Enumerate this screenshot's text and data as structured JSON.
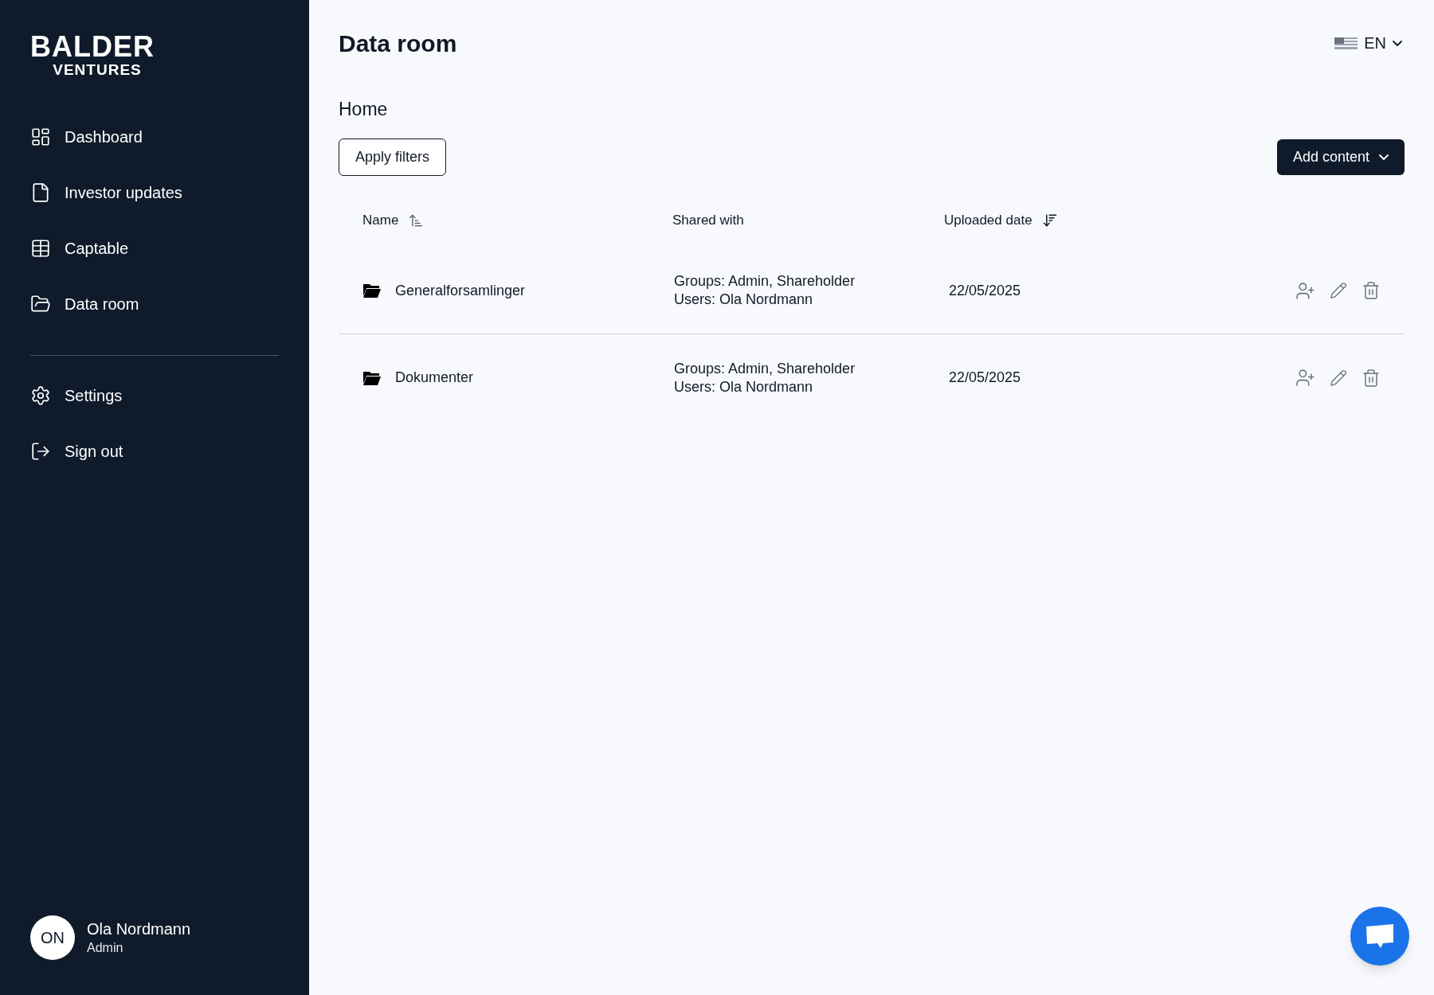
{
  "logo": {
    "line_1": "BALDER",
    "line_2": "VENTURES"
  },
  "nav": [
    {
      "label": "Dashboard"
    },
    {
      "label": "Investor updates"
    },
    {
      "label": "Captable"
    },
    {
      "label": "Data room"
    }
  ],
  "nav_secondary": [
    {
      "label": "Settings"
    },
    {
      "label": "Sign out"
    }
  ],
  "user": {
    "initials": "ON",
    "name": "Ola Nordmann",
    "role": "Admin"
  },
  "page": {
    "title": "Data room",
    "language": "EN"
  },
  "breadcrumb": "Home",
  "toolbar": {
    "filter_button": "Apply filters",
    "add_button": "Add content"
  },
  "table": {
    "columns": [
      {
        "label": "Name",
        "kind": "ascending"
      },
      {
        "label": "Shared with",
        "kind": "plain"
      },
      {
        "label": "Uploaded date",
        "kind": "descending"
      }
    ],
    "rows": [
      {
        "name": "Generalforsamlinger",
        "groups": "Groups: Admin, Shareholder",
        "users": "Users: Ola Nordmann",
        "date": "22/05/2025"
      },
      {
        "name": "Dokumenter",
        "groups": "Groups: Admin, Shareholder",
        "users": "Users: Ola Nordmann",
        "date": "22/05/2025"
      }
    ]
  }
}
